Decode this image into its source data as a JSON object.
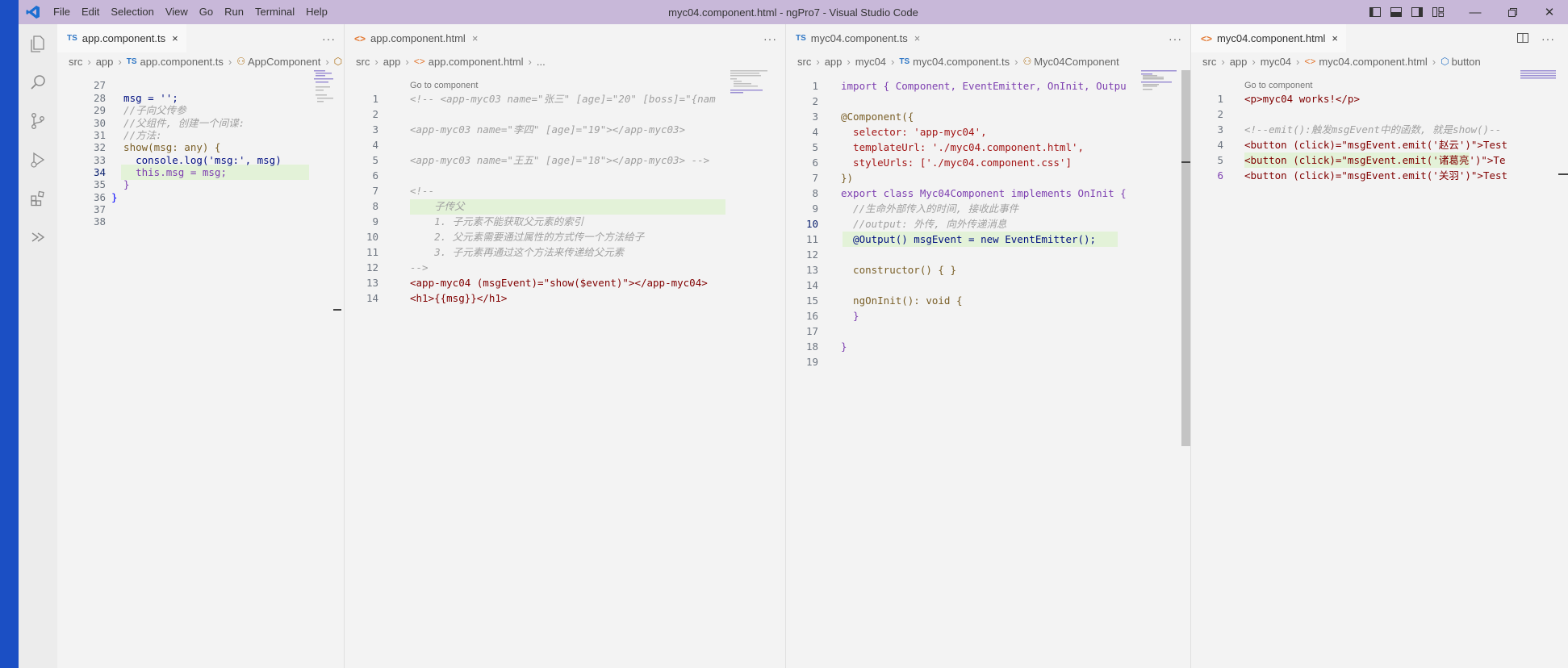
{
  "window": {
    "title": "myc04.component.html - ngPro7 - Visual Studio Code",
    "menu": [
      "File",
      "Edit",
      "Selection",
      "View",
      "Go",
      "Run",
      "Terminal",
      "Help"
    ]
  },
  "groups": [
    {
      "tab": {
        "icon": "TS",
        "label": "app.component.ts",
        "close": "×"
      },
      "breadcrumb": [
        "src",
        "app",
        "app.component.ts",
        "AppComponent"
      ],
      "line_numbers": [
        "27",
        "28",
        "29",
        "30",
        "31",
        "32",
        "33",
        "34",
        "35",
        "36",
        "37",
        "38"
      ],
      "current_line": "34"
    },
    {
      "tab": {
        "icon": "<>",
        "label": "app.component.html",
        "close": "×"
      },
      "breadcrumb": [
        "src",
        "app",
        "app.component.html",
        "..."
      ],
      "codelens": "Go to component",
      "line_numbers": [
        "1",
        "2",
        "3",
        "4",
        "5",
        "6",
        "7",
        "8",
        "9",
        "10",
        "11",
        "12",
        "13",
        "14"
      ]
    },
    {
      "tab": {
        "icon": "TS",
        "label": "myc04.component.ts",
        "close": "×"
      },
      "breadcrumb": [
        "src",
        "app",
        "myc04",
        "myc04.component.ts",
        "Myc04Component"
      ],
      "line_numbers": [
        "1",
        "2",
        "3",
        "4",
        "5",
        "6",
        "7",
        "8",
        "9",
        "10",
        "11",
        "12",
        "13",
        "14",
        "15",
        "16",
        "17",
        "18",
        "19"
      ],
      "current_line": "10"
    },
    {
      "tab": {
        "icon": "<>",
        "label": "myc04.component.html",
        "close": "×"
      },
      "breadcrumb": [
        "src",
        "app",
        "myc04",
        "myc04.component.html",
        "button"
      ],
      "codelens": "Go to component",
      "line_numbers": [
        "1",
        "2",
        "3",
        "4",
        "5",
        "6"
      ],
      "current_line": "6"
    }
  ],
  "code": {
    "g1": [
      "  msg = '';",
      "  //子向父传参",
      "  //父组件, 创建一个间谍:",
      "  //方法:",
      "  show(msg: any) {",
      "    console.log('msg:', msg)",
      "    this.msg = msg;",
      "  }",
      "}"
    ],
    "g2": [
      "<!-- <app-myc03 name=\"张三\" [age]=\"20\" [boss]=\"{nam",
      "<app-myc03 name=\"李四\" [age]=\"19\"></app-myc03>",
      "<app-myc03 name=\"王五\" [age]=\"18\"></app-myc03> -->",
      "<!--",
      "    子传父",
      "    1. 子元素不能获取父元素的索引",
      "    2. 父元素需要通过属性的方式传一个方法给子",
      "    3. 子元素再通过这个方法来传递给父元素",
      "-->",
      "<app-myc04 (msgEvent)=\"show($event)\"></app-myc04>",
      "<h1>{{msg}}</h1>"
    ],
    "g3": [
      "import { Component, EventEmitter, OnInit, Outpu",
      "@Component({",
      "  selector: 'app-myc04',",
      "  templateUrl: './myc04.component.html',",
      "  styleUrls: ['./myc04.component.css']",
      "})",
      "export class Myc04Component implements OnInit {",
      "  //生命外部传入的时间, 接收此事件",
      "  //output: 外传, 向外传递消息",
      "  @Output() msgEvent = new EventEmitter();",
      "  constructor() { }",
      "  ngOnInit(): void {",
      "  }",
      "}"
    ],
    "g4": [
      "<p>myc04 works!</p>",
      "<!--emit():触发msgEvent中的函数, 就是show()--",
      "<button (click)=\"msgEvent.emit('赵云')\">Test",
      "<button (click)=\"msgEvent.emit('诸葛亮')\">Te",
      "<button (click)=\"msgEvent.emit('关羽')\">Test"
    ]
  },
  "colors": {
    "titlebar": "#c8b8d9",
    "accent_strip": "#1b4fc4",
    "line_highlight": "#e3f2d8"
  },
  "icons": [
    "vscode-logo-icon",
    "explorer-icon",
    "search-icon",
    "source-control-icon",
    "run-debug-icon",
    "extensions-icon",
    "remote-icon"
  ]
}
